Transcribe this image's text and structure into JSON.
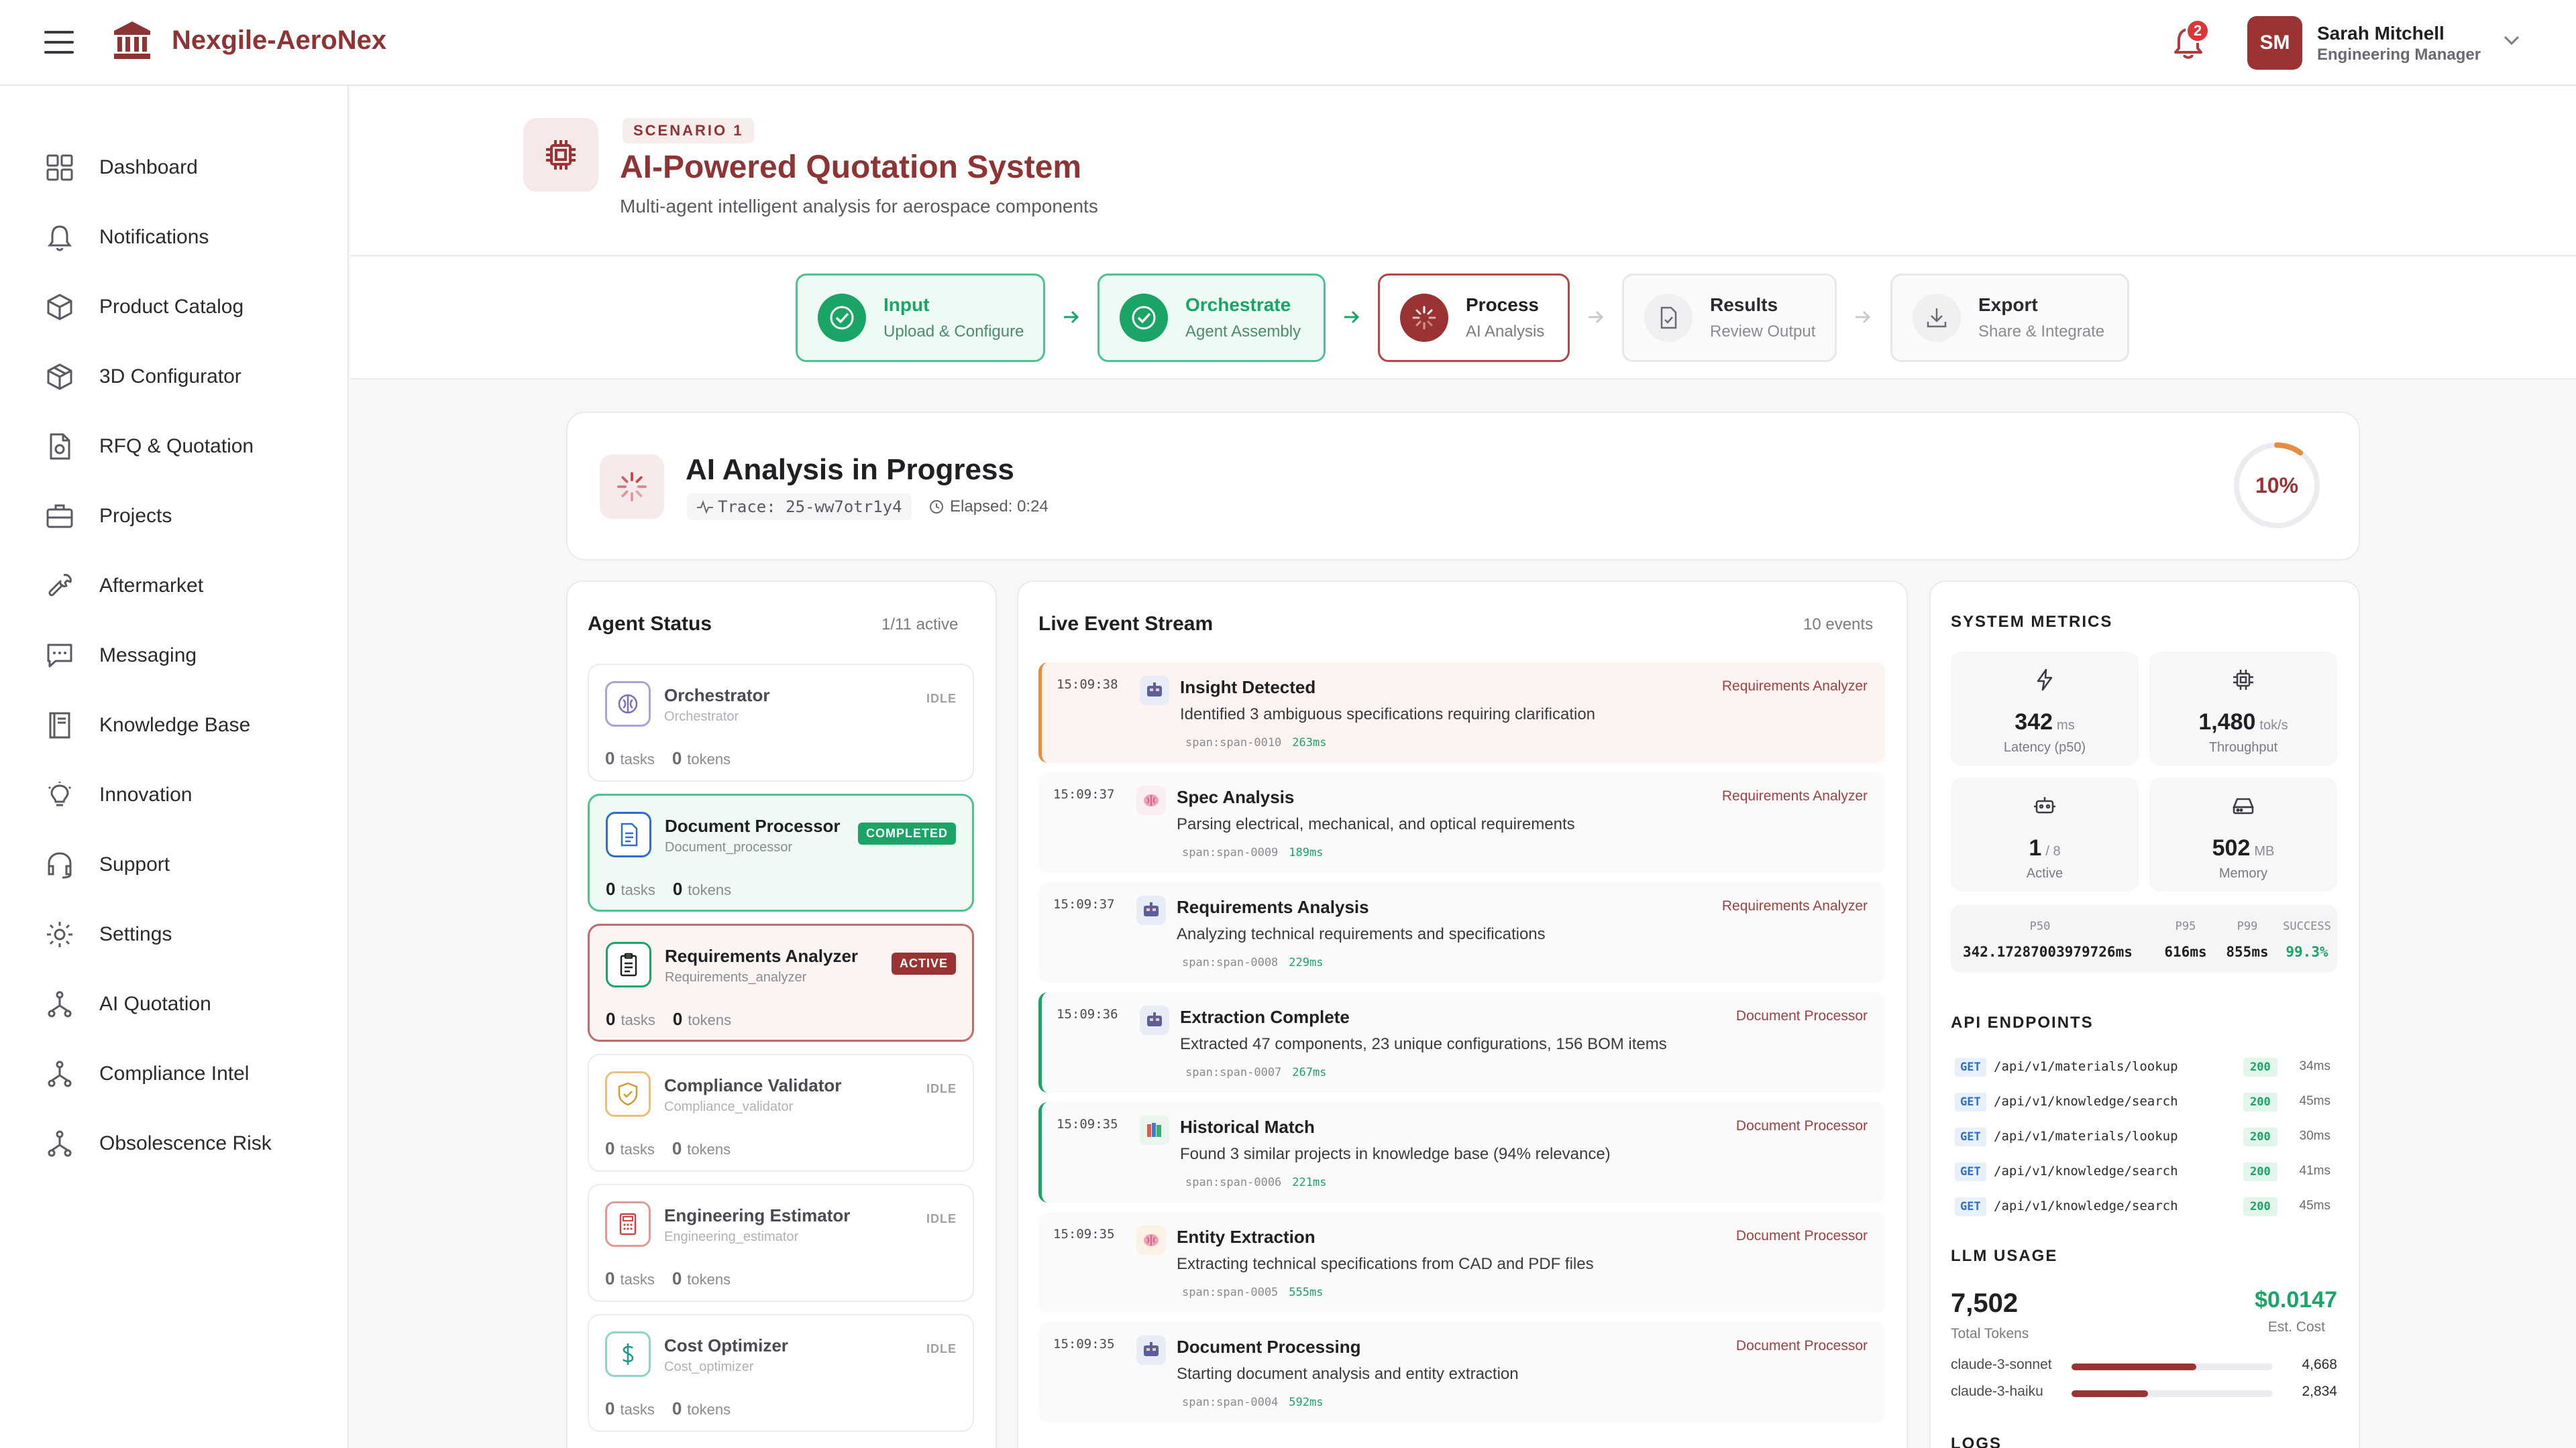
{
  "app": {
    "brand": "Nexgile-AeroNex"
  },
  "header": {
    "notification_count": "2",
    "user": {
      "initials": "SM",
      "name": "Sarah Mitchell",
      "role": "Engineering Manager"
    }
  },
  "sidebar": {
    "items": [
      {
        "label": "Dashboard",
        "icon": "dashboard-icon"
      },
      {
        "label": "Notifications",
        "icon": "bell-icon"
      },
      {
        "label": "Product Catalog",
        "icon": "box-icon"
      },
      {
        "label": "3D Configurator",
        "icon": "cube-icon"
      },
      {
        "label": "RFQ & Quotation",
        "icon": "file-dollar-icon"
      },
      {
        "label": "Projects",
        "icon": "briefcase-icon"
      },
      {
        "label": "Aftermarket",
        "icon": "wrench-icon"
      },
      {
        "label": "Messaging",
        "icon": "message-icon"
      },
      {
        "label": "Knowledge Base",
        "icon": "book-icon"
      },
      {
        "label": "Innovation",
        "icon": "lightbulb-icon"
      },
      {
        "label": "Support",
        "icon": "headset-icon"
      },
      {
        "label": "Settings",
        "icon": "gear-icon"
      },
      {
        "label": "AI Quotation",
        "icon": "network-icon"
      },
      {
        "label": "Compliance Intel",
        "icon": "network-icon"
      },
      {
        "label": "Obsolescence Risk",
        "icon": "network-icon"
      }
    ]
  },
  "page": {
    "scenario": "SCENARIO 1",
    "title": "AI-Powered Quotation System",
    "subtitle": "Multi-agent intelligent analysis for aerospace components"
  },
  "steps": [
    {
      "title": "Input",
      "sub": "Upload & Configure",
      "state": "done"
    },
    {
      "title": "Orchestrate",
      "sub": "Agent Assembly",
      "state": "done"
    },
    {
      "title": "Process",
      "sub": "AI Analysis",
      "state": "active"
    },
    {
      "title": "Results",
      "sub": "Review Output",
      "state": "todo"
    },
    {
      "title": "Export",
      "sub": "Share & Integrate",
      "state": "todo"
    }
  ],
  "progress": {
    "title": "AI Analysis in Progress",
    "trace": "Trace: 25-ww7otr1y4",
    "elapsed": "Elapsed: 0:24",
    "percent_label": "10%",
    "percent": 10
  },
  "agents": {
    "title": "Agent Status",
    "meta": "1/11 active",
    "tasks_label": "tasks",
    "tokens_label": "tokens",
    "items": [
      {
        "name": "Orchestrator",
        "sub": "Orchestrator",
        "status": "IDLE",
        "tasks": "0",
        "tokens": "0",
        "color": "#7a6fc0"
      },
      {
        "name": "Document Processor",
        "sub": "Document_processor",
        "status": "COMPLETED",
        "tasks": "0",
        "tokens": "0",
        "color": "#2f6fc8"
      },
      {
        "name": "Requirements Analyzer",
        "sub": "Requirements_analyzer",
        "status": "ACTIVE",
        "tasks": "0",
        "tokens": "0",
        "color": "#1aa466"
      },
      {
        "name": "Compliance Validator",
        "sub": "Compliance_validator",
        "status": "IDLE",
        "tasks": "0",
        "tokens": "0",
        "color": "#d89a2a"
      },
      {
        "name": "Engineering Estimator",
        "sub": "Engineering_estimator",
        "status": "IDLE",
        "tasks": "0",
        "tokens": "0",
        "color": "#c84646"
      },
      {
        "name": "Cost Optimizer",
        "sub": "Cost_optimizer",
        "status": "IDLE",
        "tasks": "0",
        "tokens": "0",
        "color": "#1a9a8a"
      }
    ]
  },
  "events": {
    "title": "Live Event Stream",
    "meta": "10 events",
    "items": [
      {
        "time": "15:09:38",
        "title": "Insight Detected",
        "desc": "Identified 3 ambiguous specifications requiring clarification",
        "span": "span:span-0010",
        "dur": "263ms",
        "source": "Requirements Analyzer",
        "hl": "orange",
        "icon": "robot-icon"
      },
      {
        "time": "15:09:37",
        "title": "Spec Analysis",
        "desc": "Parsing electrical, mechanical, and optical requirements",
        "span": "span:span-0009",
        "dur": "189ms",
        "source": "Requirements Analyzer",
        "hl": "",
        "icon": "brain-icon"
      },
      {
        "time": "15:09:37",
        "title": "Requirements Analysis",
        "desc": "Analyzing technical requirements and specifications",
        "span": "span:span-0008",
        "dur": "229ms",
        "source": "Requirements Analyzer",
        "hl": "",
        "icon": "robot-icon"
      },
      {
        "time": "15:09:36",
        "title": "Extraction Complete",
        "desc": "Extracted 47 components, 23 unique configurations, 156 BOM items",
        "span": "span:span-0007",
        "dur": "267ms",
        "source": "Document Processor",
        "hl": "green",
        "icon": "robot-icon"
      },
      {
        "time": "15:09:35",
        "title": "Historical Match",
        "desc": "Found 3 similar projects in knowledge base (94% relevance)",
        "span": "span:span-0006",
        "dur": "221ms",
        "source": "Document Processor",
        "hl": "green",
        "icon": "books-icon"
      },
      {
        "time": "15:09:35",
        "title": "Entity Extraction",
        "desc": "Extracting technical specifications from CAD and PDF files",
        "span": "span:span-0005",
        "dur": "555ms",
        "source": "Document Processor",
        "hl": "",
        "icon": "brain-icon"
      },
      {
        "time": "15:09:35",
        "title": "Document Processing",
        "desc": "Starting document analysis and entity extraction",
        "span": "span:span-0004",
        "dur": "592ms",
        "source": "Document Processor",
        "hl": "",
        "icon": "robot-icon"
      }
    ]
  },
  "metrics": {
    "title": "SYSTEM METRICS",
    "tiles": [
      {
        "value": "342",
        "unit": "ms",
        "label": "Latency (p50)",
        "icon": "lightning-icon"
      },
      {
        "value": "1,480",
        "unit": "tok/s",
        "label": "Throughput",
        "icon": "cpu-icon"
      },
      {
        "value": "1",
        "unit": "/ 8",
        "label": "Active",
        "icon": "bot-icon"
      },
      {
        "value": "502",
        "unit": "MB",
        "label": "Memory",
        "icon": "storage-icon"
      }
    ],
    "percentiles": [
      {
        "label": "P50",
        "value": "342.17287003979726ms"
      },
      {
        "label": "P95",
        "value": "616ms"
      },
      {
        "label": "P99",
        "value": "855ms"
      },
      {
        "label": "SUCCESS",
        "value": "99.3%"
      }
    ]
  },
  "api": {
    "title": "API ENDPOINTS",
    "items": [
      {
        "method": "GET",
        "path": "/api/v1/materials/lookup",
        "code": "200",
        "latency": "34ms"
      },
      {
        "method": "GET",
        "path": "/api/v1/knowledge/search",
        "code": "200",
        "latency": "45ms"
      },
      {
        "method": "GET",
        "path": "/api/v1/materials/lookup",
        "code": "200",
        "latency": "30ms"
      },
      {
        "method": "GET",
        "path": "/api/v1/knowledge/search",
        "code": "200",
        "latency": "41ms"
      },
      {
        "method": "GET",
        "path": "/api/v1/knowledge/search",
        "code": "200",
        "latency": "45ms"
      }
    ]
  },
  "llm": {
    "title": "LLM USAGE",
    "total_tokens": "7,502",
    "total_label": "Total Tokens",
    "cost": "$0.0147",
    "cost_label": "Est. Cost",
    "models": [
      {
        "name": "claude-3-sonnet",
        "count": "4,668",
        "share": 0.62
      },
      {
        "name": "claude-3-haiku",
        "count": "2,834",
        "share": 0.38
      }
    ]
  },
  "logs": {
    "title": "LOGS"
  },
  "colors": {
    "brand": "#8f3434",
    "accent": "#9b3333",
    "success": "#1aa466",
    "warning": "#e88c40"
  }
}
